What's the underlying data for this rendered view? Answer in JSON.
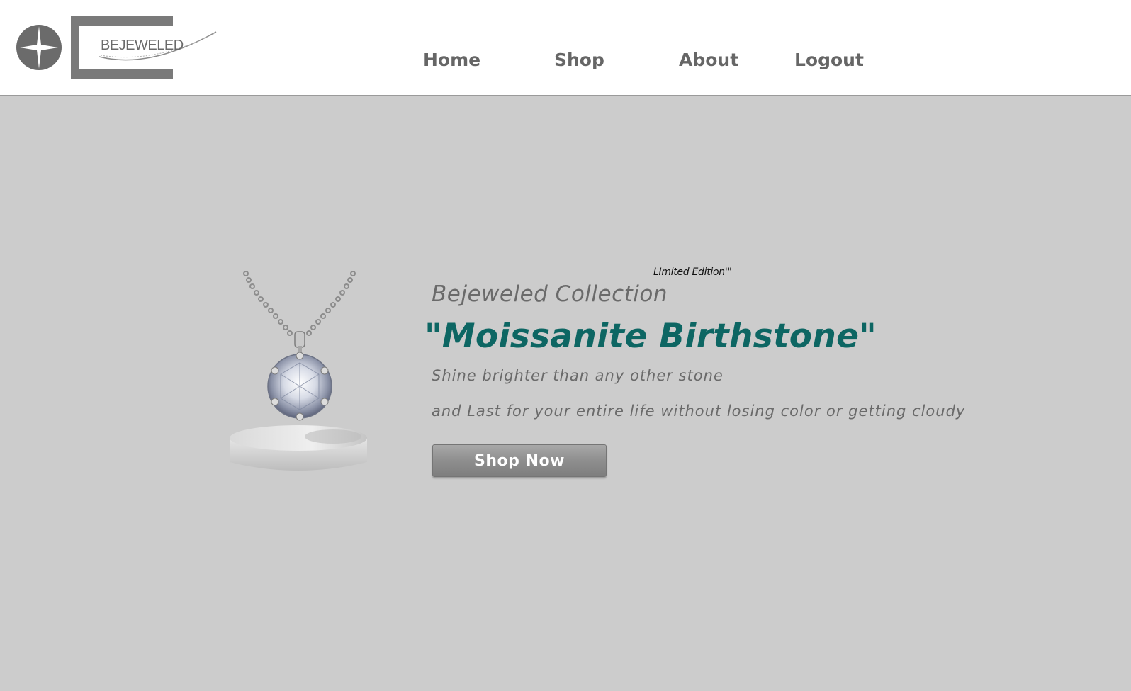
{
  "brand": {
    "logo_text": "BEJEWELED"
  },
  "nav": {
    "home": "Home",
    "shop": "Shop",
    "about": "About",
    "logout": "Logout"
  },
  "hero": {
    "badge": "LImited Edition'\"",
    "collection": "Bejeweled Collection",
    "title": "\"Moissanite Birthstone\"",
    "line1": "Shine brighter than any other stone",
    "line2": "and Last for your entire life without losing color or getting cloudy",
    "cta": "Shop Now"
  },
  "colors": {
    "background": "#cccccc",
    "header": "#ffffff",
    "accent": "#0d6663",
    "text": "#6a6a6a",
    "button": "#8e8e8e"
  },
  "icons": {
    "logo": "star-circle-logo",
    "product": "necklace-pendant-image"
  }
}
